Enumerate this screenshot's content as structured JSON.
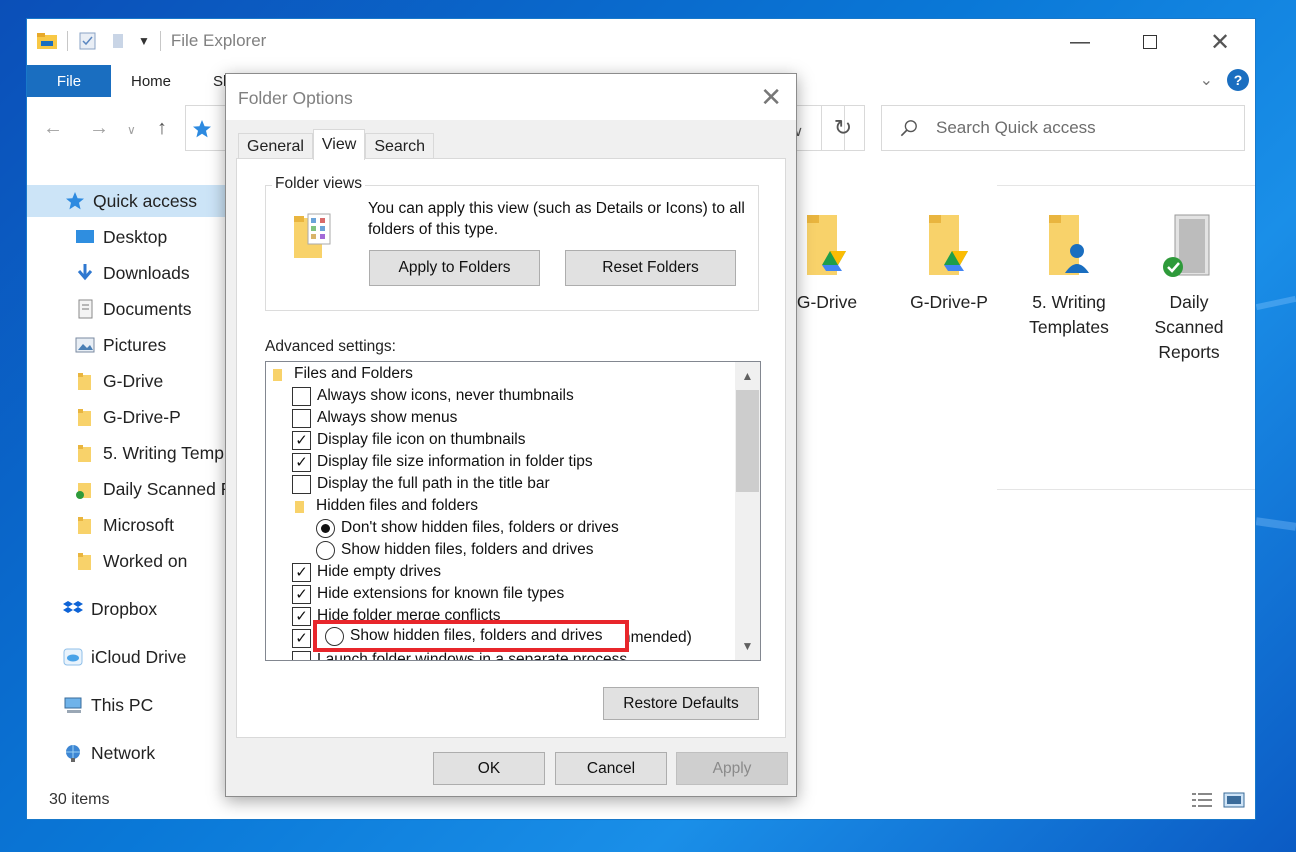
{
  "explorer": {
    "title": "File Explorer",
    "ribbon_tabs": [
      "File",
      "Home",
      "Sh"
    ],
    "search_placeholder": "Search Quick access",
    "status_items": "30 items",
    "sidebar": [
      {
        "label": "Quick access",
        "icon": "star-icon"
      },
      {
        "label": "Desktop",
        "icon": "desktop-icon"
      },
      {
        "label": "Downloads",
        "icon": "download-arrow-icon"
      },
      {
        "label": "Documents",
        "icon": "documents-icon"
      },
      {
        "label": "Pictures",
        "icon": "pictures-icon"
      },
      {
        "label": "G-Drive",
        "icon": "folder-icon"
      },
      {
        "label": "G-Drive-P",
        "icon": "folder-icon"
      },
      {
        "label": "5. Writing Temp",
        "icon": "folder-icon"
      },
      {
        "label": "Daily Scanned R",
        "icon": "folder-synced-icon"
      },
      {
        "label": "Microsoft",
        "icon": "folder-icon"
      },
      {
        "label": "Worked on",
        "icon": "folder-icon"
      },
      {
        "label": "Dropbox",
        "icon": "dropbox-icon"
      },
      {
        "label": "iCloud Drive",
        "icon": "icloud-icon"
      },
      {
        "label": "This PC",
        "icon": "computer-icon"
      },
      {
        "label": "Network",
        "icon": "network-icon"
      }
    ],
    "tiles": [
      {
        "label": "G-Drive"
      },
      {
        "label": "G-Drive-P"
      },
      {
        "label": "5. Writing Templates"
      },
      {
        "label": "Daily Scanned Reports"
      }
    ]
  },
  "dialog": {
    "title": "Folder Options",
    "tabs": [
      "General",
      "View",
      "Search"
    ],
    "active_tab": "View",
    "folder_views": {
      "legend": "Folder views",
      "description": "You can apply this view (such as Details or Icons) to all folders of this type.",
      "apply_button": "Apply to Folders",
      "reset_button": "Reset Folders"
    },
    "advanced_label": "Advanced settings:",
    "tree": [
      {
        "type": "folder",
        "label": "Files and Folders",
        "indent": 0
      },
      {
        "type": "checkbox",
        "label": "Always show icons, never thumbnails",
        "checked": false
      },
      {
        "type": "checkbox",
        "label": "Always show menus",
        "checked": false
      },
      {
        "type": "checkbox",
        "label": "Display file icon on thumbnails",
        "checked": true
      },
      {
        "type": "checkbox",
        "label": "Display file size information in folder tips",
        "checked": true
      },
      {
        "type": "checkbox",
        "label": "Display the full path in the title bar",
        "checked": false
      },
      {
        "type": "folder",
        "label": "Hidden files and folders",
        "indent": 1
      },
      {
        "type": "radio",
        "label": "Don't show hidden files, folders or drives",
        "selected": true
      },
      {
        "type": "radio",
        "label": "Show hidden files, folders and drives",
        "selected": false
      },
      {
        "type": "checkbox",
        "label": "Hide empty drives",
        "checked": true
      },
      {
        "type": "checkbox",
        "label": "Hide extensions for known file types",
        "checked": true
      },
      {
        "type": "checkbox",
        "label": "Hide folder merge conflicts",
        "checked": true
      },
      {
        "type": "checkbox",
        "label": "Hide protected operating system files (Recommended)",
        "checked": true
      },
      {
        "type": "checkbox",
        "label": "Launch folder windows in a separate process",
        "checked": false
      }
    ],
    "highlighted_option": "Show hidden files, folders and drives",
    "restore_button": "Restore Defaults",
    "ok_button": "OK",
    "cancel_button": "Cancel",
    "apply_button": "Apply"
  },
  "colors": {
    "accent": "#1a6ec0",
    "highlight_border": "#e8262b",
    "folder_yellow": "#f8d26a"
  }
}
